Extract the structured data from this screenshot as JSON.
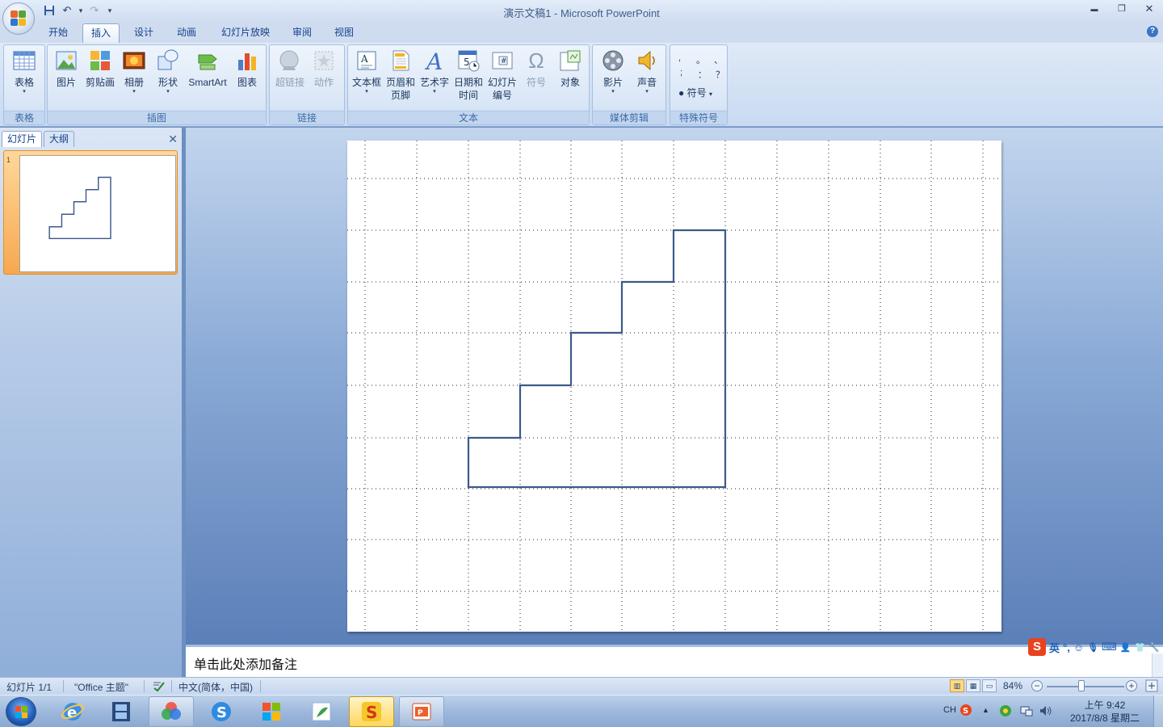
{
  "window": {
    "title": "演示文稿1 - Microsoft PowerPoint",
    "minimize": "▬",
    "restore": "❐",
    "close": "✕"
  },
  "qat": {
    "save": "💾",
    "undo": "↶",
    "redo": "↷",
    "more": "▾"
  },
  "tabs": [
    {
      "label": "开始"
    },
    {
      "label": "插入"
    },
    {
      "label": "设计"
    },
    {
      "label": "动画"
    },
    {
      "label": "幻灯片放映"
    },
    {
      "label": "审阅"
    },
    {
      "label": "视图"
    }
  ],
  "active_tab": "插入",
  "help": "?",
  "ribbon": {
    "groups": {
      "tables": "表格",
      "illustrations": "插图",
      "links": "链接",
      "text": "文本",
      "media": "媒体剪辑",
      "special": "特殊符号"
    },
    "buttons": {
      "table": "表格",
      "picture": "图片",
      "clipart": "剪贴画",
      "album": "相册",
      "shapes": "形状",
      "smartart": "SmartArt",
      "chart": "图表",
      "hyperlink": "超链接",
      "action": "动作",
      "textbox": "文本框",
      "header_footer_1": "页眉和",
      "header_footer_2": "页脚",
      "wordart": "艺术字",
      "datetime_1": "日期和",
      "datetime_2": "时间",
      "slide_number_1": "幻灯片",
      "slide_number_2": "编号",
      "symbol": "符号",
      "object": "对象",
      "movie": "影片",
      "sound": "声音",
      "special_symbol": "符号"
    },
    "special_chars": [
      ",",
      "。",
      "、",
      ";",
      "：",
      "？"
    ]
  },
  "left_pane": {
    "tab_slides": "幻灯片",
    "tab_outline": "大纲",
    "close": "✕",
    "slide_number": "1"
  },
  "notes": {
    "placeholder": "单击此处添加备注"
  },
  "ime": {
    "mode": "英",
    "punct": "°,",
    "smile": "☺",
    "mic": "🎙",
    "kbd": "⌨",
    "user": "👤",
    "shirt": "👕",
    "tool": "🔧"
  },
  "status": {
    "slide": "幻灯片 1/1",
    "theme": "\"Office 主题\"",
    "language": "中文(简体，中国)",
    "zoom": "84%",
    "zoom_level_fraction": 0.45
  },
  "taskbar": {
    "tray_lang": "CH",
    "clock_time": "上午 9:42",
    "clock_date": "2017/8/8 星期二"
  },
  "colors": {
    "accent": "#15428b",
    "stair_stroke": "#3c5a8a",
    "slide_bg": "#ffffff",
    "thumb_selected": "#f7a84f"
  }
}
